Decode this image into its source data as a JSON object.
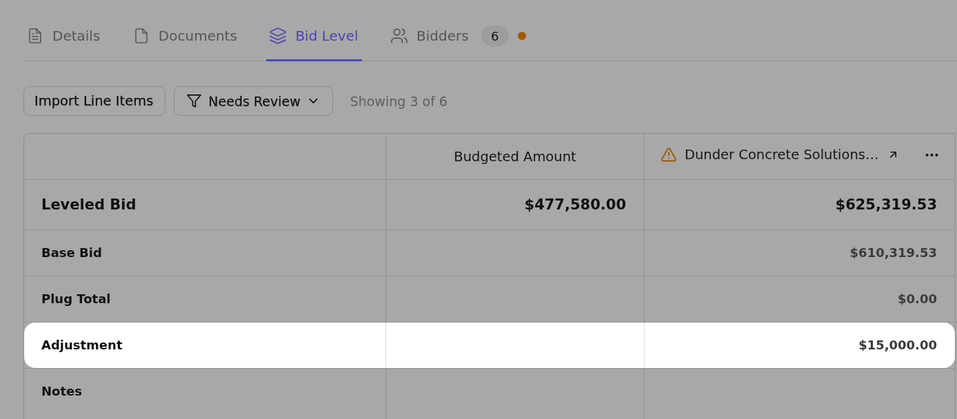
{
  "tabs": [
    {
      "label": "Details",
      "selected": false,
      "alert": false
    },
    {
      "label": "Documents",
      "selected": false,
      "alert": false
    },
    {
      "label": "Bid Level",
      "selected": true,
      "alert": false
    },
    {
      "label": "Bidders",
      "selected": false,
      "alert": true,
      "count": "6"
    }
  ],
  "toolbar": {
    "import_button": "Import Line Items",
    "filter": {
      "label": "Needs Review"
    },
    "result_count": "Showing 3 of 6"
  },
  "table": {
    "columns": [
      {
        "kind": "budget",
        "label": "Budgeted Amount",
        "warning": false
      },
      {
        "kind": "bidder",
        "label": "Dunder Concrete Solutions…",
        "warning": true
      }
    ],
    "rows": [
      {
        "kind": "total",
        "label": "Leveled Bid",
        "highlighted": false,
        "budgeted_amount": "$477,580.00",
        "bid": "$625,319.53"
      },
      {
        "kind": "line",
        "label": "Base Bid",
        "highlighted": false,
        "bid": "$610,319.53"
      },
      {
        "kind": "line",
        "label": "Plug Total",
        "highlighted": false,
        "bid": "$0.00"
      },
      {
        "kind": "line",
        "label": "Adjustment",
        "highlighted": true,
        "bid": "$15,000.00"
      },
      {
        "kind": "line",
        "label": "Notes",
        "highlighted": false
      }
    ]
  }
}
